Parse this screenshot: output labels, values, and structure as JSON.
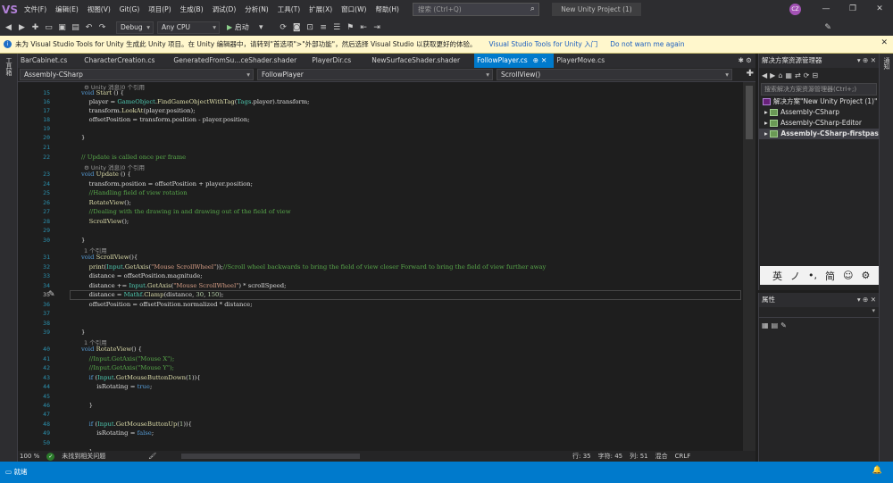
{
  "title_bar": {
    "logo": "VS",
    "menu": [
      "文件(F)",
      "编辑(E)",
      "视图(V)",
      "Git(G)",
      "项目(P)",
      "生成(B)",
      "调试(D)",
      "分析(N)",
      "工具(T)",
      "扩展(X)",
      "窗口(W)",
      "帮助(H)"
    ],
    "search_placeholder": "搜索 (Ctrl+Q)",
    "project_name": "New Unity Project (1)",
    "user_initials": "CZ"
  },
  "toolbar": {
    "config": "Debug",
    "platform": "Any CPU",
    "start_label": "启动"
  },
  "info_bar": {
    "message": "未为 Visual Studio Tools for Unity 生成此 Unity 项目。在 Unity 编辑器中，请转到\"首选项\">\"外部功能\"，然后选择 Visual Studio 以获取更好的体验。",
    "link_intro": "Visual Studio Tools for Unity 入门",
    "link_dismiss": "Do not warn me again"
  },
  "left_strip_label": "工具箱",
  "right_strip_label": "通知",
  "tabs": [
    {
      "label": "BarCabinet.cs",
      "active": false
    },
    {
      "label": "CharacterCreation.cs",
      "active": false
    },
    {
      "label": "GeneratedFromSu...ceShader.shader",
      "active": false
    },
    {
      "label": "PlayerDir.cs",
      "active": false
    },
    {
      "label": "NewSurfaceShader.shader",
      "active": false
    },
    {
      "label": "FollowPlayer.cs",
      "active": true
    },
    {
      "label": "PlayerMove.cs",
      "active": false
    }
  ],
  "nav": {
    "project": "Assembly-CSharp",
    "class": "FollowPlayer",
    "member": "ScrollView()"
  },
  "code": {
    "lens_start": "Unity 消息|0 个引用",
    "lens_update": "Unity 消息|0 个引用",
    "lens_ref1": "1 个引用",
    "lens_ref2": "1 个引用",
    "line_numbers": [
      "15",
      "16",
      "17",
      "18",
      "19",
      "20",
      "21",
      "22",
      "23",
      "24",
      "25",
      "26",
      "27",
      "28",
      "29",
      "30",
      "31",
      "32",
      "33",
      "34",
      "35",
      "36",
      "37",
      "38",
      "39",
      "40",
      "41",
      "42",
      "43",
      "44",
      "45",
      "46",
      "47",
      "48",
      "49",
      "50"
    ],
    "current_line": "35"
  },
  "status_line": {
    "zoom": "100 %",
    "issues": "未找到相关问题",
    "row": "行: 35",
    "col": "字符: 45",
    "pos": "列: 51",
    "tabs": "混合",
    "eol": "CRLF"
  },
  "solution_explorer": {
    "title": "解决方案资源管理器",
    "search_placeholder": "搜索解决方案资源管理器(Ctrl+;)",
    "items": [
      {
        "label": "解决方案\"New Unity Project (1)\"",
        "level": 0,
        "bold": false
      },
      {
        "label": "Assembly-CSharp",
        "level": 1,
        "bold": false
      },
      {
        "label": "Assembly-CSharp-Editor",
        "level": 1,
        "bold": false
      },
      {
        "label": "Assembly-CSharp-firstpass",
        "level": 1,
        "bold": true
      }
    ]
  },
  "ime": [
    "英",
    "ノ",
    "•,",
    "简",
    "☺",
    "⚙"
  ],
  "properties": {
    "title": "属性"
  },
  "bottom_bar": {
    "ready": "就绪"
  }
}
